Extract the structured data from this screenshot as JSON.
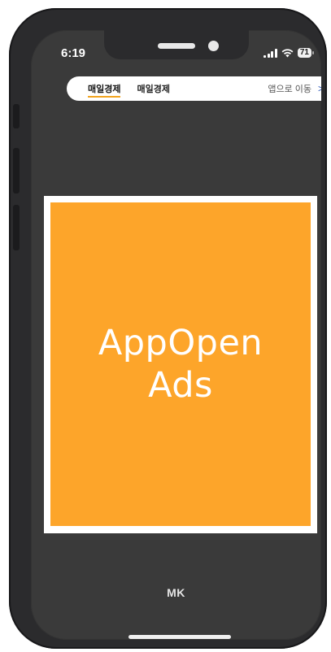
{
  "status_bar": {
    "time": "6:19",
    "battery": "71",
    "icons": [
      "signal-icon",
      "wifi-icon",
      "battery-icon"
    ]
  },
  "top_bar": {
    "tab_logo": "매일경제",
    "brand": "매일경제",
    "go_app_label": "앱으로 이동",
    "go_app_chevron": ">"
  },
  "ad": {
    "line1": "AppOpen",
    "line2": "Ads",
    "background": "#fda52a"
  },
  "footer": {
    "logo": "MK"
  }
}
